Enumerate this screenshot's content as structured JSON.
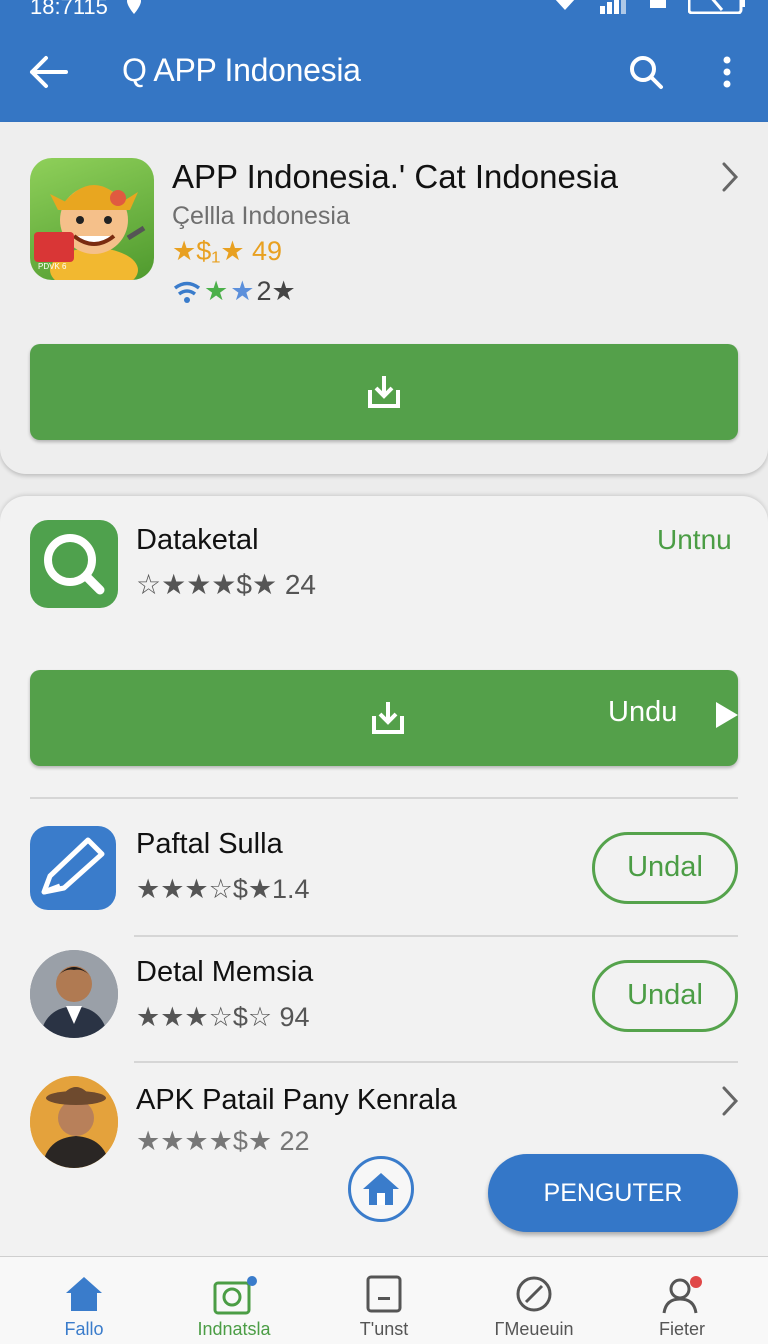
{
  "status": {
    "time": "18:7115"
  },
  "header": {
    "title": "Q APP Indonesia"
  },
  "featured": {
    "title": "APP Indonesia.' Cat Indonesia",
    "developer": "Çellla Indonesia",
    "rating": "★$₁★ 49",
    "reviews": "2★",
    "icon_badge": "PDVK 6"
  },
  "second": {
    "title": "Dataketal",
    "action": "Untnu",
    "rating": "☆★★★$★ 24",
    "button_label": "Undu"
  },
  "list": [
    {
      "title": "Paftal Sulla",
      "rating": "★★★☆$★1.4",
      "button": "Undal"
    },
    {
      "title": "Detal Memsia",
      "rating": "★★★☆$☆ 94",
      "button": "Undal"
    },
    {
      "title": "APK Patail Pany Kenrala",
      "rating": "★★★★$★ 22"
    }
  ],
  "fab": {
    "label": "PENGUTER"
  },
  "bottom_nav": [
    {
      "label": "Fallo"
    },
    {
      "label": "Indnatsla"
    },
    {
      "label": "T'unst"
    },
    {
      "label": "ΓMeueuin"
    },
    {
      "label": "Fieter"
    }
  ],
  "colors": {
    "primary": "#3576c4",
    "green": "#54a04a",
    "star_gold": "#e8a020",
    "star_blue": "#3a7ccb",
    "star_green": "#4bb04a"
  }
}
